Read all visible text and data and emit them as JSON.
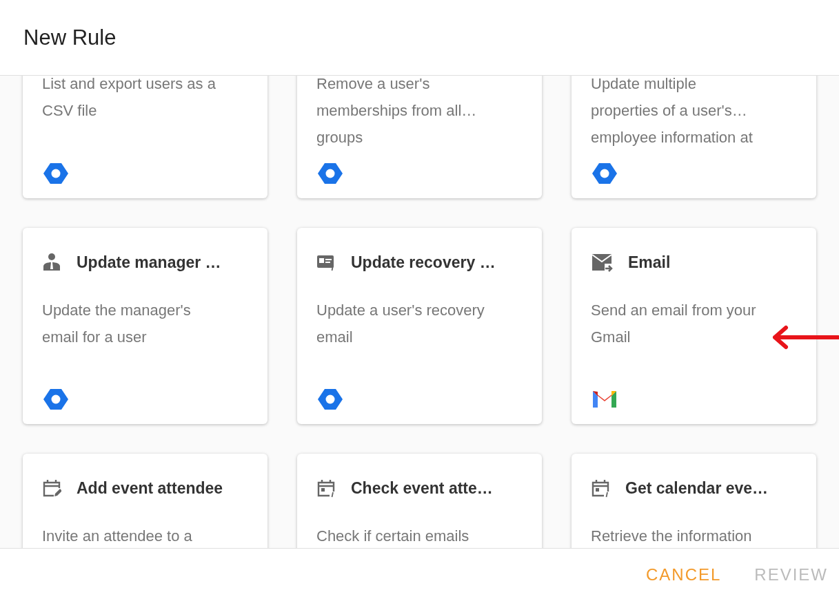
{
  "dialog": {
    "title": "New Rule"
  },
  "cards": [
    {
      "kind": "clipped",
      "description": "List and export users as a\nCSV file"
    },
    {
      "kind": "clipped",
      "description": "Remove a user's\nmemberships from all…\ngroups"
    },
    {
      "kind": "clipped",
      "description": "Update multiple\nproperties of a user's…\nemployee information at"
    },
    {
      "kind": "manager",
      "title": "Update manager …",
      "description": "Update the manager's\nemail for a user"
    },
    {
      "kind": "recovery",
      "title": "Update recovery …",
      "description": "Update a user's recovery\nemail"
    },
    {
      "kind": "email",
      "title": "Email",
      "description": "Send an email from your\nGmail"
    },
    {
      "kind": "calendaredit",
      "title": "Add event attendee",
      "description": "Invite an attendee to a"
    },
    {
      "kind": "calendarinfo",
      "title": "Check event atte…",
      "description": "Check if certain emails"
    },
    {
      "kind": "calendarinfo",
      "title": "Get calendar eve…",
      "description": "Retrieve the information"
    }
  ],
  "buttons": [
    {
      "label": "CANCEL",
      "disabled": false
    },
    {
      "label": "REVIEW",
      "disabled": true
    }
  ]
}
